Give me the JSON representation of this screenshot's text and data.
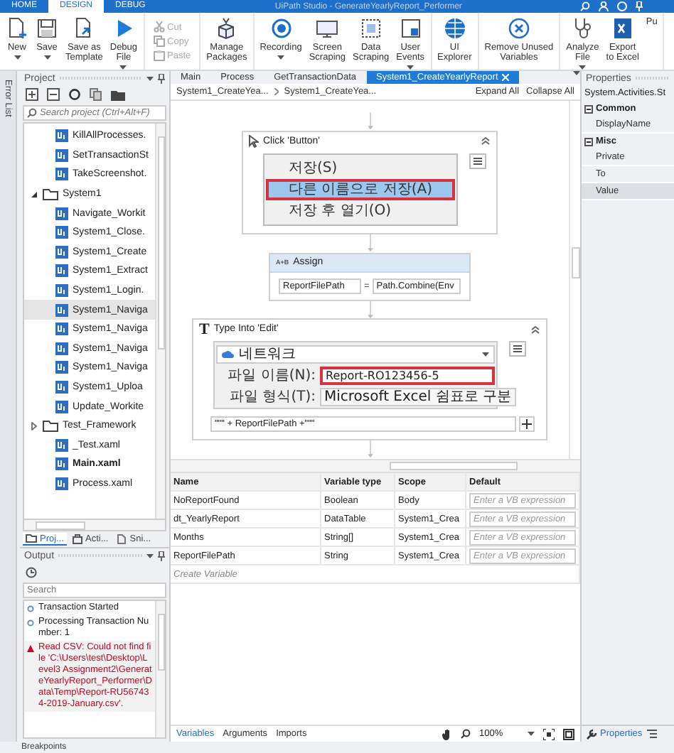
{
  "title_bar": {
    "tabs": [
      {
        "label": "HOME",
        "selected": false
      },
      {
        "label": "DESIGN",
        "selected": true
      },
      {
        "label": "DEBUG",
        "selected": false
      }
    ],
    "title": "UiPath Studio - GenerateYearlyReport_Performer"
  },
  "ribbon": {
    "groups": [
      {
        "items": [
          {
            "kind": "new",
            "label": "New",
            "dropdown": true
          },
          {
            "kind": "save",
            "label": "Save",
            "dropdown": true
          },
          {
            "kind": "template",
            "label": "Save as\nTemplate",
            "dropdown": false
          },
          {
            "kind": "debug",
            "label": "Debug\nFile",
            "dropdown": true
          }
        ]
      },
      {
        "small": [
          {
            "kind": "cut",
            "label": "Cut",
            "disabled": true
          },
          {
            "kind": "copy",
            "label": "Copy",
            "disabled": true
          },
          {
            "kind": "paste",
            "label": "Paste",
            "disabled": true
          }
        ]
      },
      {
        "items": [
          {
            "kind": "packages",
            "label": "Manage\nPackages",
            "dropdown": false
          }
        ]
      },
      {
        "items": [
          {
            "kind": "recording",
            "label": "Recording",
            "dropdown": true
          },
          {
            "kind": "screen",
            "label": "Screen\nScraping",
            "dropdown": false
          },
          {
            "kind": "data",
            "label": "Data\nScraping",
            "dropdown": false
          },
          {
            "kind": "events",
            "label": "User\nEvents",
            "dropdown": true
          }
        ]
      },
      {
        "items": [
          {
            "kind": "explorer",
            "label": "UI\nExplorer",
            "dropdown": false
          }
        ]
      },
      {
        "items": [
          {
            "kind": "remove",
            "label": "Remove Unused\nVariables",
            "dropdown": false
          }
        ]
      },
      {
        "items": [
          {
            "kind": "analyze",
            "label": "Analyze\nFile",
            "dropdown": true
          },
          {
            "kind": "excel",
            "label": "Export\nto Excel",
            "dropdown": false
          },
          {
            "kind": "cut_off",
            "label": "Pu",
            "dropdown": false
          }
        ]
      }
    ]
  },
  "error_strip": {
    "label": "Error List"
  },
  "project": {
    "title": "Project",
    "search": {
      "placeholder": "Search project (Ctrl+Alt+F)"
    },
    "tree": [
      {
        "kind": "file",
        "label": "KillAllProcesses.",
        "selected": false,
        "bold": false
      },
      {
        "kind": "file",
        "label": "SetTransactionSt",
        "selected": false,
        "bold": false
      },
      {
        "kind": "file",
        "label": "TakeScreenshot.",
        "selected": false,
        "bold": false
      },
      {
        "kind": "folder",
        "label": "System1",
        "selected": false,
        "expanded": true,
        "children": [
          {
            "kind": "file",
            "label": "Navigate_Workit",
            "selected": false,
            "bold": false
          },
          {
            "kind": "file",
            "label": "System1_Close.",
            "selected": false,
            "bold": false
          },
          {
            "kind": "file",
            "label": "System1_Create",
            "selected": false,
            "bold": false
          },
          {
            "kind": "file",
            "label": "System1_Extract",
            "selected": false,
            "bold": false
          },
          {
            "kind": "file",
            "label": "System1_Login.",
            "selected": false,
            "bold": false
          },
          {
            "kind": "file",
            "label": "System1_Naviga",
            "selected": true,
            "bold": false
          },
          {
            "kind": "file",
            "label": "System1_Naviga",
            "selected": false,
            "bold": false
          },
          {
            "kind": "file",
            "label": "System1_Naviga",
            "selected": false,
            "bold": false
          },
          {
            "kind": "file",
            "label": "System1_Naviga",
            "selected": false,
            "bold": false
          },
          {
            "kind": "file",
            "label": "System1_Uploa",
            "selected": false,
            "bold": false
          },
          {
            "kind": "file",
            "label": "Update_Workite",
            "selected": false,
            "bold": false
          }
        ]
      },
      {
        "kind": "folder",
        "label": "Test_Framework",
        "selected": false,
        "expanded": false
      },
      {
        "kind": "file",
        "label": "_Test.xaml",
        "selected": false,
        "bold": false
      },
      {
        "kind": "file",
        "label": "Main.xaml",
        "selected": false,
        "bold": true
      },
      {
        "kind": "file",
        "label": "Process.xaml",
        "selected": false,
        "bold": false
      }
    ],
    "tabs": [
      {
        "kind": "folder",
        "label": "Proj...",
        "selected": true
      },
      {
        "kind": "activities",
        "label": "Acti...",
        "selected": false
      },
      {
        "kind": "snippets",
        "label": "Sni...",
        "selected": false
      }
    ]
  },
  "output": {
    "title": "Output",
    "search": {
      "placeholder": "Search"
    },
    "entries": [
      {
        "kind": "info",
        "text": "Transaction Started"
      },
      {
        "kind": "info",
        "text": "Processing Transaction Number: 1"
      },
      {
        "kind": "error",
        "text": "Read CSV: Could not find file 'C:\\Users\\test\\Desktop\\Level3 Assignment2\\GenerateYearlyReport_Performer\\Data\\Temp\\Report-RU567434-2019-January.csv'."
      }
    ]
  },
  "designer": {
    "tabs": [
      {
        "label": "Main",
        "selected": false
      },
      {
        "label": "Process",
        "selected": false
      },
      {
        "label": "GetTransactionData",
        "selected": false
      },
      {
        "label": "System1_CreateYearlyReport",
        "selected": true
      }
    ],
    "breadcrumb": [
      "System1_CreateYea...",
      "System1_CreateYea..."
    ],
    "expand_all": "Expand All",
    "collapse_all": "Collapse All",
    "activities": [
      {
        "kind": "click",
        "title": "Click 'Button'",
        "menu": [
          {
            "label": "저장(S)",
            "selected": false
          },
          {
            "label": "다른 이름으로 저장(A)",
            "selected": true
          },
          {
            "label": "저장 후 열기(O)",
            "selected": false
          }
        ]
      },
      {
        "kind": "assign",
        "icon": "A+B",
        "title": "Assign",
        "to": "ReportFilePath",
        "operator": "=",
        "value": "Path.Combine(Env"
      },
      {
        "kind": "type_into",
        "icon": "T",
        "title": "Type Into 'Edit'",
        "location": "네트워크",
        "filename_label": "파일 이름(N):",
        "filename": "Report-RO123456-5",
        "filetype_label": "파일 형식(T):",
        "filetype": "Microsoft Excel 쉼표로 구분",
        "text": "\"\"\" + ReportFilePath +\"\"\""
      }
    ]
  },
  "variables": {
    "columns": [
      "Name",
      "Variable type",
      "Scope",
      "Default"
    ],
    "rows": [
      {
        "name": "NoReportFound",
        "type": "Boolean",
        "scope": "Body",
        "placeholder": "Enter a VB expression"
      },
      {
        "name": "dt_YearlyReport",
        "type": "DataTable",
        "scope": "System1_Crea",
        "placeholder": "Enter a VB expression"
      },
      {
        "name": "Months",
        "type": "String[]",
        "scope": "System1_Crea",
        "placeholder": "Enter a VB expression"
      },
      {
        "name": "ReportFilePath",
        "type": "String",
        "scope": "System1_Crea",
        "placeholder": "Enter a VB expression"
      }
    ],
    "create": "Create Variable"
  },
  "bottom_bar": {
    "tabs": [
      {
        "label": "Variables",
        "selected": true
      },
      {
        "label": "Arguments",
        "selected": false
      },
      {
        "label": "Imports",
        "selected": false
      }
    ],
    "zoom": "100%"
  },
  "properties": {
    "title": "Properties",
    "type": "System.Activities.St",
    "categories": [
      {
        "label": "Common",
        "expanded": true,
        "items": [
          {
            "label": "DisplayName",
            "selected": false
          }
        ]
      },
      {
        "label": "Misc",
        "expanded": true,
        "items": [
          {
            "label": "Private",
            "selected": false
          },
          {
            "label": "To",
            "selected": false
          },
          {
            "label": "Value",
            "selected": true
          }
        ]
      }
    ],
    "tab": "Properties"
  },
  "status": {
    "label": "Breakpoints"
  }
}
